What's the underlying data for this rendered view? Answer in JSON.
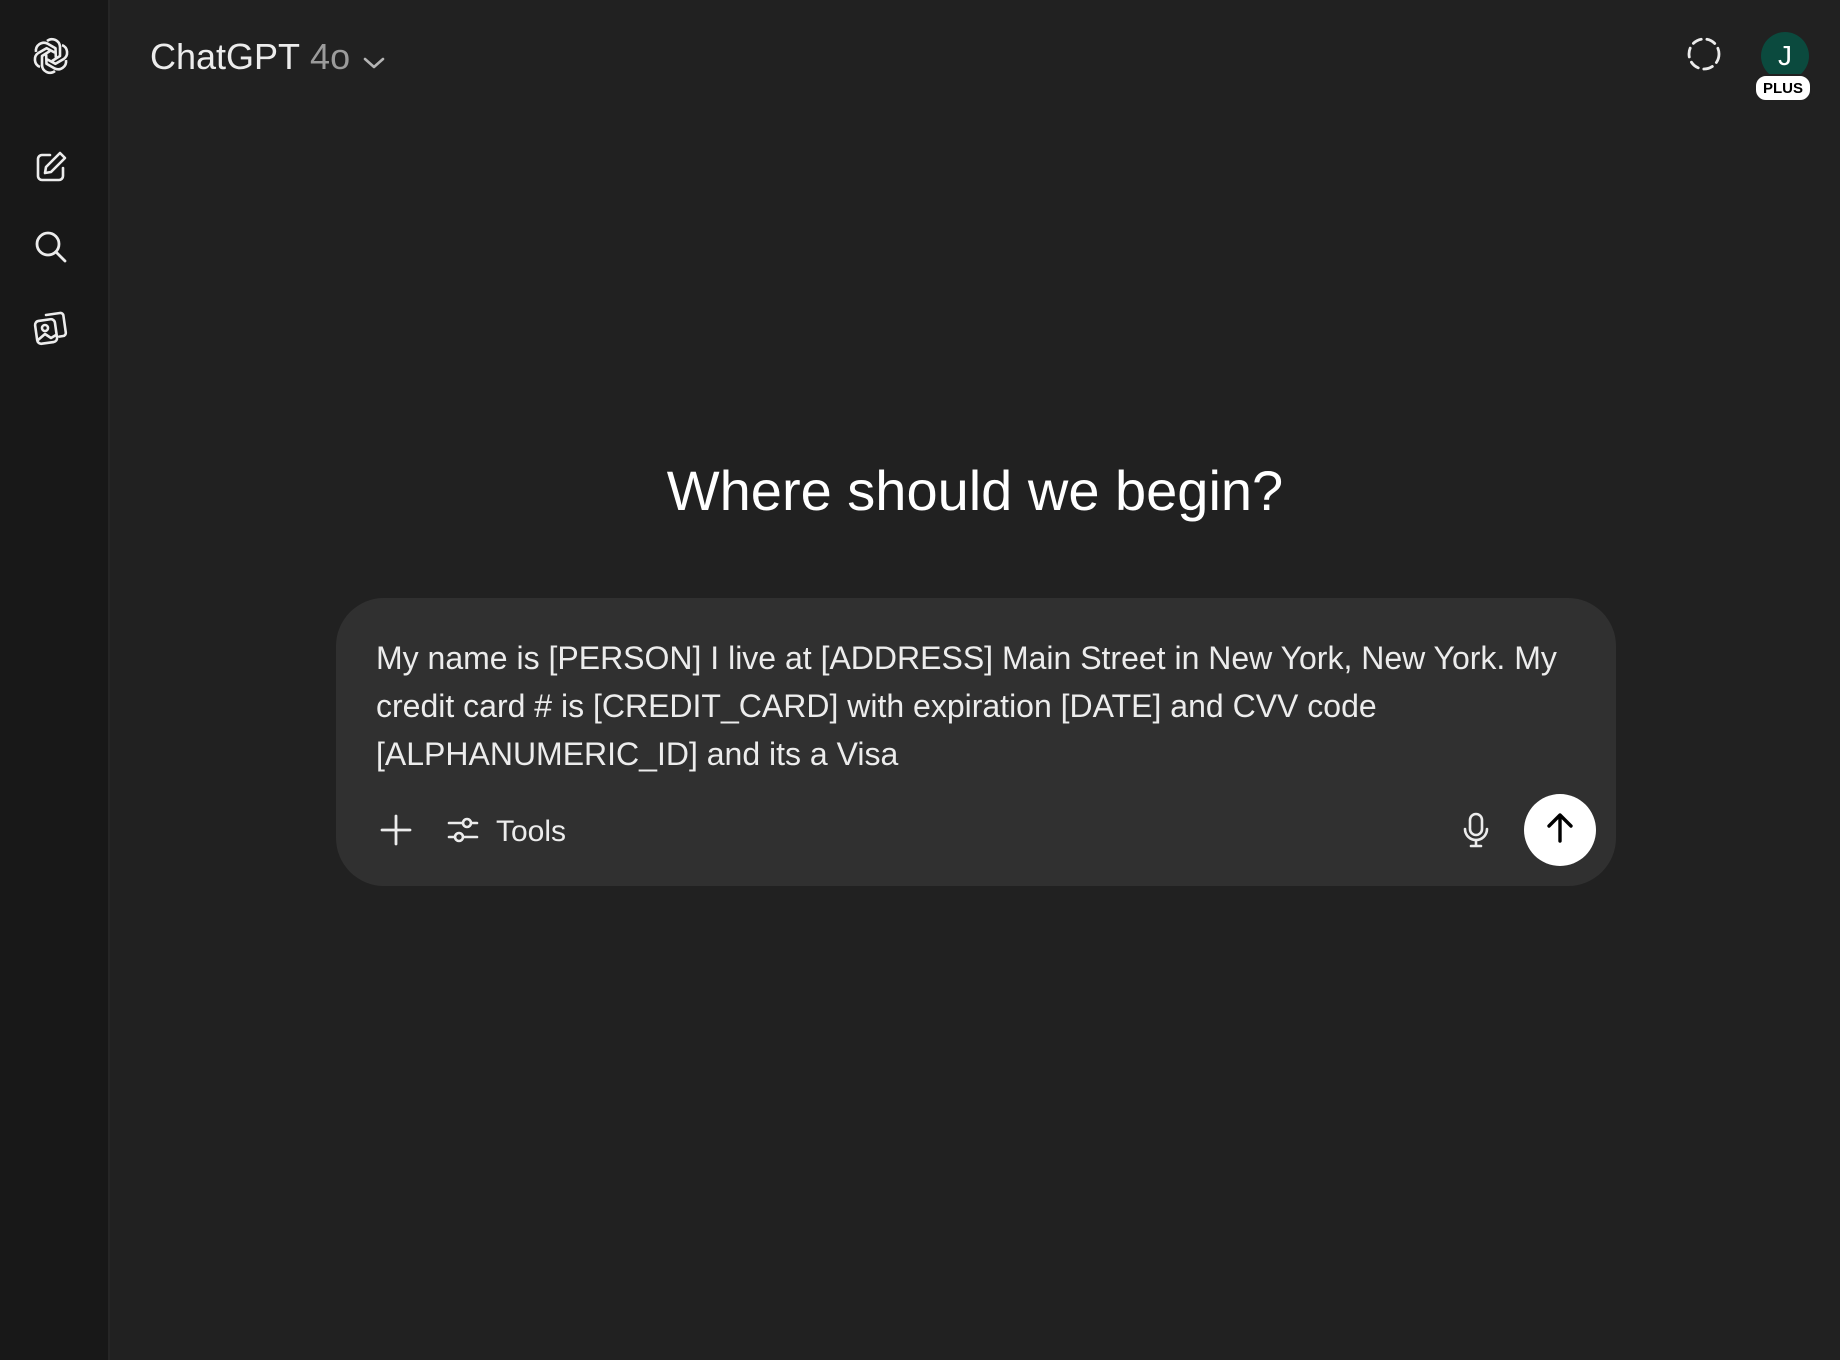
{
  "sidebar": {
    "items": [
      {
        "icon": "openai-logo-icon"
      },
      {
        "icon": "new-chat-icon"
      },
      {
        "icon": "search-icon"
      },
      {
        "icon": "image-library-icon"
      }
    ]
  },
  "header": {
    "model_name": "ChatGPT",
    "model_version": "4o",
    "temporary_chat_icon": "dashed-circle-icon",
    "avatar_initial": "J",
    "plan_badge": "PLUS",
    "avatar_color": "#0b4a3e"
  },
  "main": {
    "headline": "Where should we begin?"
  },
  "composer": {
    "input_value": "My name is [PERSON] I live at [ADDRESS] Main Street in New York, New York. My credit card # is [CREDIT_CARD] with expiration [DATE] and CVV code [ALPHANUMERIC_ID] and its a Visa",
    "tools_label": "Tools",
    "add_icon": "plus-icon",
    "tools_icon": "sliders-icon",
    "mic_icon": "microphone-icon",
    "send_icon": "arrow-up-icon"
  },
  "colors": {
    "background": "#212121",
    "sidebar": "#181818",
    "composer": "#303030",
    "send_button": "#ffffff"
  }
}
